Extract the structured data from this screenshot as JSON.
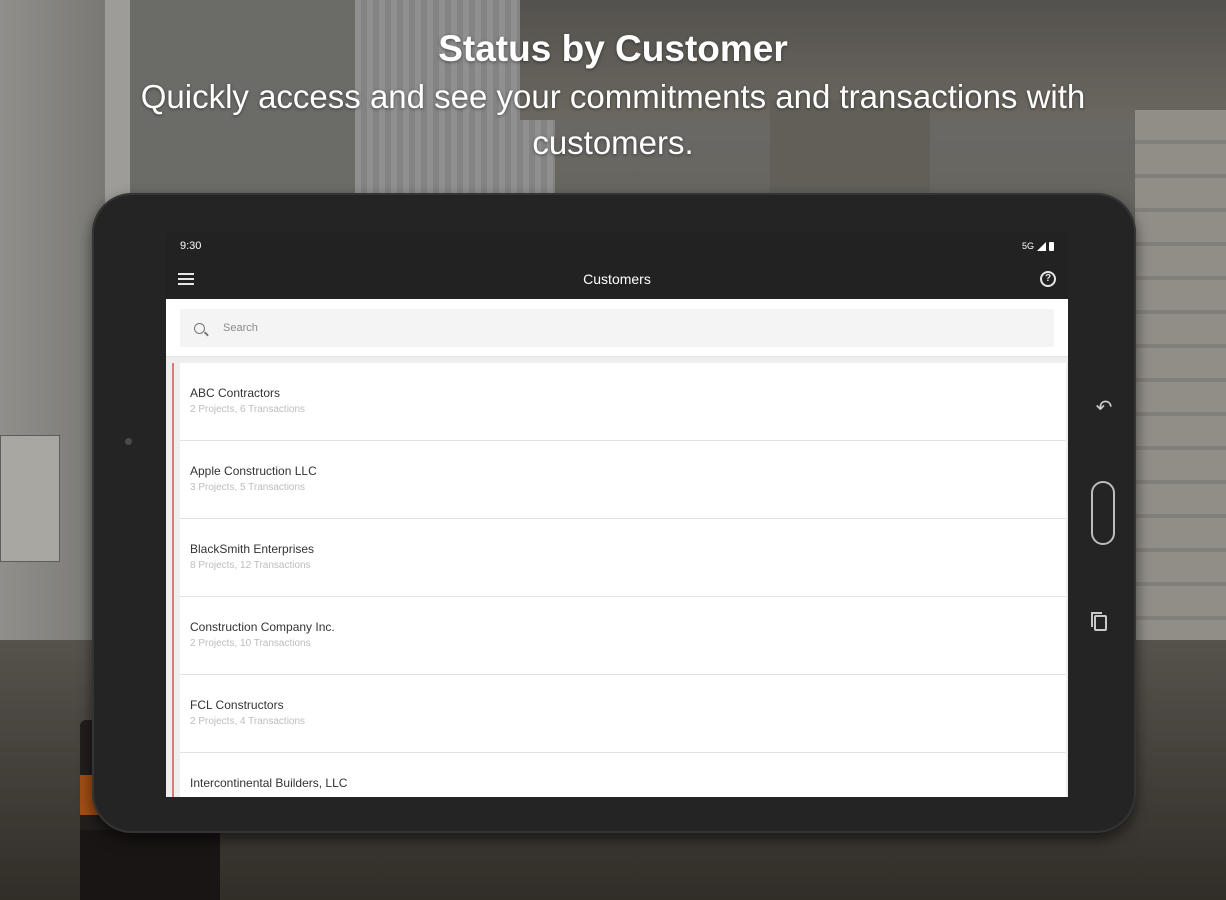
{
  "headline": {
    "title": "Status by Customer",
    "subtitle": "Quickly access and see your commitments and transactions with customers."
  },
  "status_bar": {
    "time": "9:30",
    "network": "5G"
  },
  "app_bar": {
    "title": "Customers",
    "menu_icon": "menu-icon",
    "help_icon": "help-icon"
  },
  "search": {
    "placeholder": "Search",
    "value": ""
  },
  "customers": [
    {
      "name": "ABC Contractors",
      "summary": "2 Projects, 6 Transactions"
    },
    {
      "name": "Apple Construction LLC",
      "summary": "3 Projects, 5 Transactions"
    },
    {
      "name": "BlackSmith Enterprises",
      "summary": "8 Projects, 12 Transactions"
    },
    {
      "name": "Construction Company Inc.",
      "summary": "2 Projects, 10 Transactions"
    },
    {
      "name": "FCL Constructors",
      "summary": "2 Projects, 4 Transactions"
    },
    {
      "name": "Intercontinental Builders, LLC",
      "summary": ""
    }
  ],
  "colors": {
    "app_bar": "#222222",
    "list_accent": "#e07a7a"
  }
}
